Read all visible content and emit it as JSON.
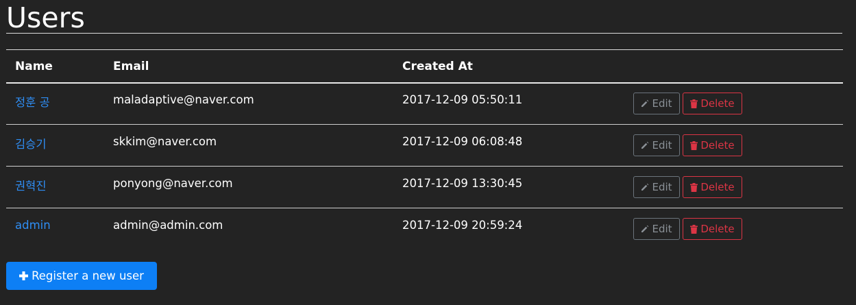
{
  "page": {
    "title": "Users"
  },
  "table": {
    "headers": {
      "name": "Name",
      "email": "Email",
      "created_at": "Created At"
    },
    "rows": [
      {
        "name": "정훈 공",
        "email": "maladaptive@naver.com",
        "created_at": "2017-12-09 05:50:11",
        "edit_label": "Edit",
        "delete_label": "Delete"
      },
      {
        "name": "김승기",
        "email": "skkim@naver.com",
        "created_at": "2017-12-09 06:08:48",
        "edit_label": "Edit",
        "delete_label": "Delete"
      },
      {
        "name": "권혁진",
        "email": "ponyong@naver.com",
        "created_at": "2017-12-09 13:30:45",
        "edit_label": "Edit",
        "delete_label": "Delete"
      },
      {
        "name": "admin",
        "email": "admin@admin.com",
        "created_at": "2017-12-09 20:59:24",
        "edit_label": "Edit",
        "delete_label": "Delete"
      }
    ]
  },
  "actions": {
    "register_label": "Register a new user"
  },
  "icons": {
    "edit": "pencil-icon",
    "delete": "trash-icon",
    "register": "plus-icon"
  },
  "colors": {
    "background": "#232323",
    "link": "#2f8ef4",
    "danger": "#dc3545",
    "secondary": "#6c757d",
    "primary": "#0d7ff5"
  }
}
